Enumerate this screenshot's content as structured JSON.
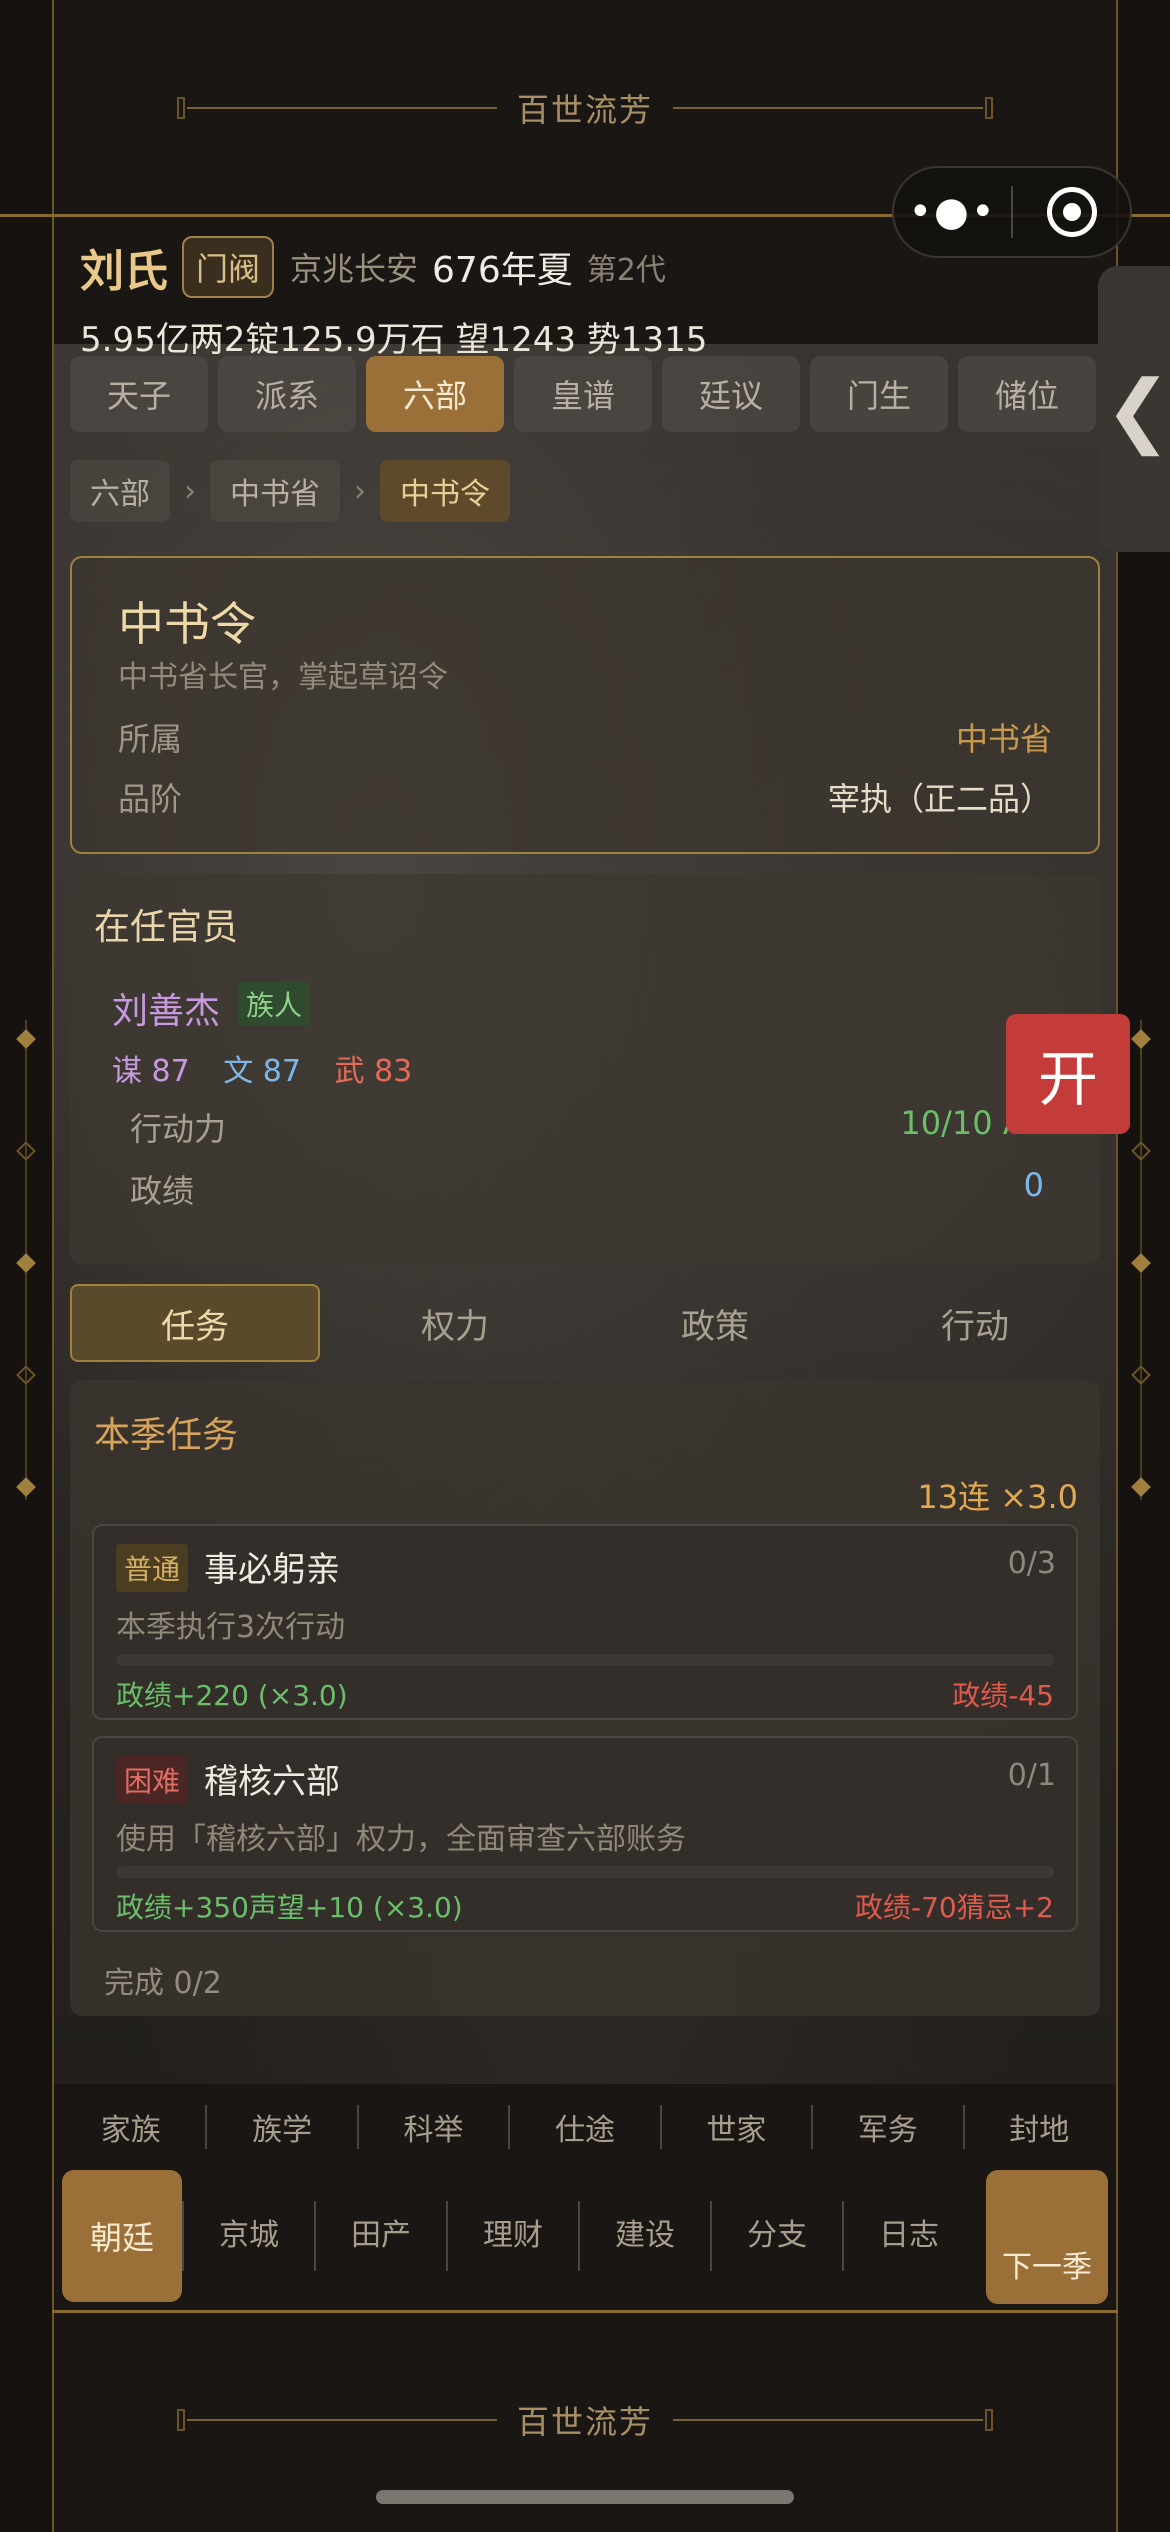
{
  "banner": {
    "title": "百世流芳"
  },
  "header": {
    "clan_name": "刘氏",
    "clan_tag": "门阀",
    "location": "京兆长安",
    "year": "676年夏",
    "generation": "第2代",
    "resources": "5.95亿两2锭125.9万石  望1243 势1315"
  },
  "capsule": {
    "more_icon": "•●•",
    "target_icon": "target-icon"
  },
  "side_tab": {
    "label": "❮"
  },
  "tabs": [
    "天子",
    "派系",
    "六部",
    "皇谱",
    "廷议",
    "门生",
    "储位"
  ],
  "active_tab": "六部",
  "breadcrumb": [
    "六部",
    "中书省",
    "中书令"
  ],
  "office": {
    "name": "中书令",
    "description": "中书省长官，掌起草诏令",
    "belongs_label": "所属",
    "belongs_value": "中书省",
    "rank_label": "品阶",
    "rank_value": "宰执（正二品）"
  },
  "official": {
    "section_title": "在任官员",
    "name": "刘善杰",
    "tag": "族人",
    "stat_mou": "谋 87",
    "stat_wen": "文 87",
    "stat_wu": "武 83",
    "ap_label": "行动力",
    "ap_value": "10/10 AP",
    "merit_label": "政绩",
    "merit_value": "0"
  },
  "float_button": {
    "label": "开"
  },
  "subtabs": [
    "任务",
    "权力",
    "政策",
    "行动"
  ],
  "tasks": {
    "title": "本季任务",
    "streak": "13连 ×3.0",
    "items": [
      {
        "level": "普通",
        "name": "事必躬亲",
        "count": "0/3",
        "desc": "本季执行3次行动",
        "reward": "政绩+220 (×3.0)",
        "penalty": "政绩-45",
        "progress": 0
      },
      {
        "level": "困难",
        "name": "稽核六部",
        "count": "0/1",
        "desc": "使用「稽核六部」权力，全面审查六部账务",
        "reward": "政绩+350声望+10 (×3.0)",
        "penalty": "政绩-70猜忌+2",
        "progress": 0
      }
    ],
    "completed": "完成 0/2"
  },
  "nav_row1": [
    "家族",
    "族学",
    "科举",
    "仕途",
    "世家",
    "军务",
    "封地"
  ],
  "nav_row2": {
    "home": "朝廷",
    "items": [
      "京城",
      "田产",
      "理财",
      "建设",
      "分支",
      "日志"
    ],
    "next": "下一季"
  },
  "colors": {
    "accent_gold": "#9a7038",
    "border_gold": "#a0803e",
    "danger": "#c43c3a",
    "positive": "#6abf6a"
  }
}
